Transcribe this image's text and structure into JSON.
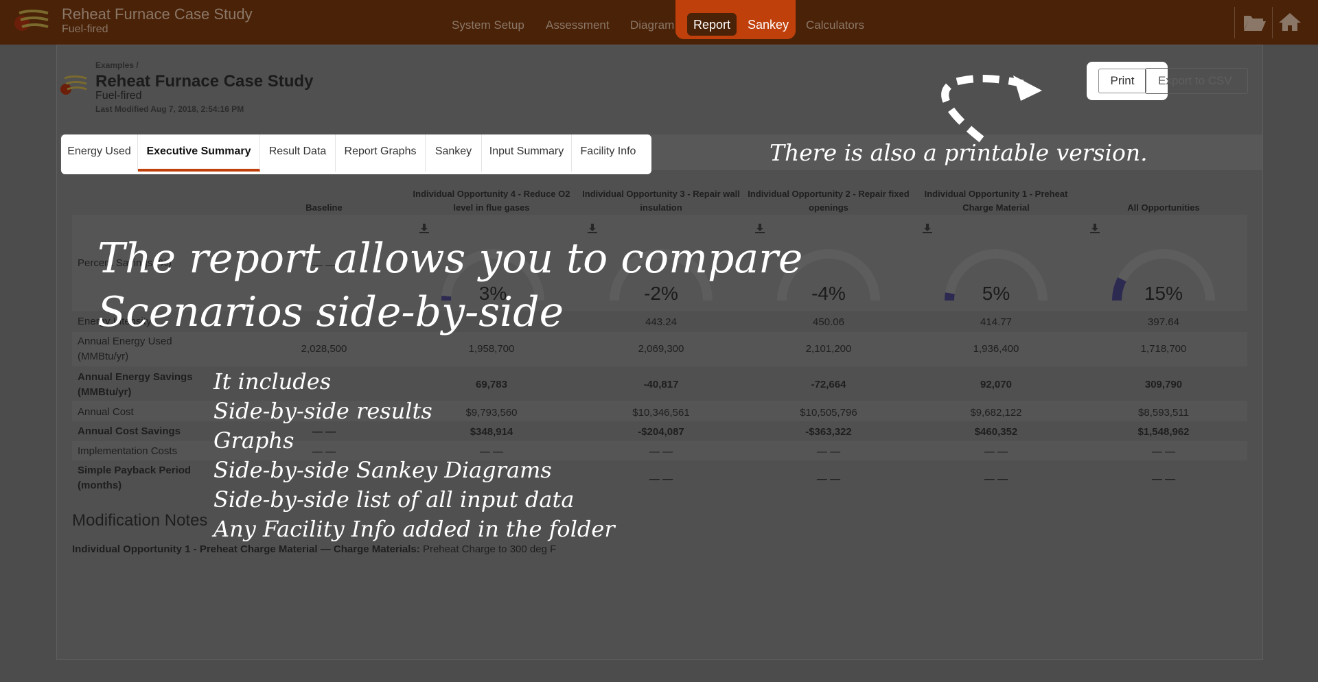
{
  "nav": {
    "app_title": "Reheat Furnace Case Study",
    "app_subtitle": "Fuel-fired",
    "links": [
      {
        "label": "System Setup"
      },
      {
        "label": "Assessment"
      },
      {
        "label": "Diagram"
      },
      {
        "label": "Report"
      },
      {
        "label": "Sankey"
      },
      {
        "label": "Calculators"
      }
    ],
    "icons": [
      "folder-open-icon",
      "home-icon"
    ],
    "accent_color": "#c0400c"
  },
  "header": {
    "breadcrumb": "Examples /",
    "title": "Reheat Furnace Case Study",
    "subtitle": "Fuel-fired",
    "last_modified": "Last Modified Aug 7, 2018, 2:54:16 PM",
    "print_label": "Print",
    "csv_label": "Export to CSV"
  },
  "tabs": [
    {
      "label": "Energy Used"
    },
    {
      "label": "Executive Summary"
    },
    {
      "label": "Result Data"
    },
    {
      "label": "Report Graphs"
    },
    {
      "label": "Sankey"
    },
    {
      "label": "Input Summary"
    },
    {
      "label": "Facility Info"
    }
  ],
  "table": {
    "columns": [
      {
        "name": "Baseline"
      },
      {
        "name": "Individual Opportunity 4 - Reduce O2 level in flue gases"
      },
      {
        "name": "Individual Opportunity 3 - Repair wall insulation"
      },
      {
        "name": "Individual Opportunity 2 - Repair fixed openings"
      },
      {
        "name": "Individual Opportunity 1 - Preheat Charge Material"
      },
      {
        "name": "All Opportunities"
      }
    ],
    "percent_savings": {
      "label": "Percent Savings (%)",
      "values": [
        "— —",
        "3%",
        "-2%",
        "-4%",
        "5%",
        "15%"
      ],
      "fractions": [
        0,
        0.03,
        -0.02,
        -0.04,
        0.05,
        0.15
      ]
    },
    "rows": [
      {
        "label": "Energy Intensity",
        "bold": false,
        "values": [
          "",
          "",
          "443.24",
          "450.06",
          "414.77",
          "397.64"
        ]
      },
      {
        "label": "Annual Energy Used (MMBtu/yr)",
        "bold": false,
        "values": [
          "2,028,500",
          "1,958,700",
          "2,069,300",
          "2,101,200",
          "1,936,400",
          "1,718,700"
        ]
      },
      {
        "label": "Annual Energy Savings (MMBtu/yr)",
        "bold": true,
        "values": [
          "",
          "69,783",
          "-40,817",
          "-72,664",
          "92,070",
          "309,790"
        ]
      },
      {
        "label": "Annual Cost",
        "bold": false,
        "values": [
          "",
          "$9,793,560",
          "$10,346,561",
          "$10,505,796",
          "$9,682,122",
          "$8,593,511"
        ]
      },
      {
        "label": "Annual Cost Savings",
        "bold": true,
        "values": [
          "— —",
          "$348,914",
          "-$204,087",
          "-$363,322",
          "$460,352",
          "$1,548,962"
        ]
      },
      {
        "label": "Implementation Costs",
        "bold": false,
        "values": [
          "— —",
          "— —",
          "— —",
          "— —",
          "— —",
          "— —"
        ]
      },
      {
        "label": "Simple Payback Period (months)",
        "bold": true,
        "values": [
          "",
          "",
          "— —",
          "— —",
          "— —",
          "— —"
        ]
      }
    ]
  },
  "notes": {
    "title": "Modification Notes",
    "line_bold": "Individual Opportunity 1 - Preheat Charge Material — Charge Materials:",
    "line_text": " Preheat Charge to 300 deg F"
  },
  "overlay": {
    "main_line1": "The report allows you to compare",
    "main_line2": "Scenarios side-by-side",
    "list": [
      "It includes",
      "Side-by-side results",
      "Graphs",
      "Side-by-side Sankey Diagrams",
      "Side-by-side list of all input data",
      "Any Facility Info added in the folder"
    ],
    "print_note": "There is also a printable version."
  }
}
